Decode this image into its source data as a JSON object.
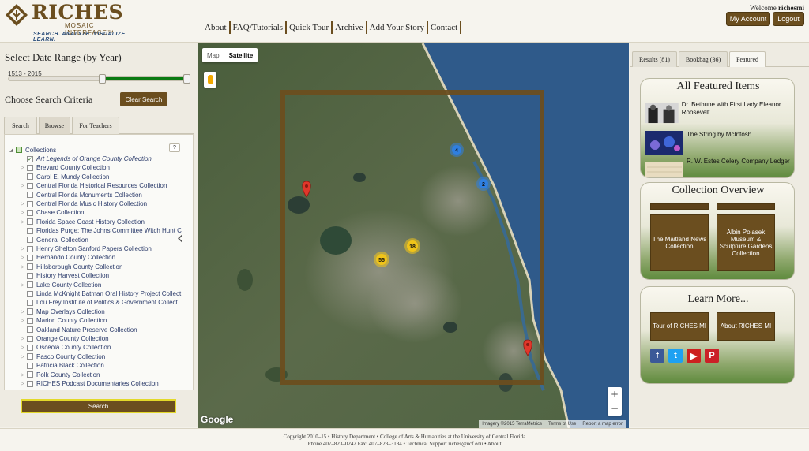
{
  "header": {
    "logo_title": "RICHES",
    "logo_subtitle": "MOSAIC INTERFACE™",
    "logo_tagline": "SEARCH. ANALYZE. VISUALIZE. LEARN.",
    "nav": [
      "About",
      "FAQ/Tutorials",
      "Quick Tour",
      "Archive",
      "Add Your Story",
      "Contact"
    ],
    "welcome_prefix": "Welcome ",
    "welcome_user": "richesmi",
    "my_account_label": "My Account",
    "logout_label": "Logout"
  },
  "left_panel": {
    "date_title": "Select Date Range (by Year)",
    "date_range": "1513 - 2015",
    "slider": {
      "min_year": 1513,
      "max_year": 2015,
      "selected_start_fraction": 0.52,
      "selected_end_fraction": 1.0
    },
    "criteria_title": "Choose Search Criteria",
    "clear_search_label": "Clear Search",
    "tabs": [
      "Search",
      "Browse",
      "For Teachers"
    ],
    "active_tab": "Browse",
    "tree_root": "Collections",
    "help_label": "?",
    "collections": [
      {
        "label": "Art Legends of Orange County Collection",
        "checked": true,
        "expandable": false,
        "italic": true
      },
      {
        "label": "Brevard County Collection",
        "checked": false,
        "expandable": true,
        "italic": false
      },
      {
        "label": "Carol E. Mundy Collection",
        "checked": false,
        "expandable": false,
        "italic": false
      },
      {
        "label": "Central Florida Historical Resources Collection",
        "checked": false,
        "expandable": true,
        "italic": false
      },
      {
        "label": "Central Florida Monuments Collection",
        "checked": false,
        "expandable": false,
        "italic": false
      },
      {
        "label": "Central Florida Music History Collection",
        "checked": false,
        "expandable": true,
        "italic": false
      },
      {
        "label": "Chase Collection",
        "checked": false,
        "expandable": true,
        "italic": false
      },
      {
        "label": "Florida Space Coast History Collection",
        "checked": false,
        "expandable": true,
        "italic": false
      },
      {
        "label": "Floridas Purge: The Johns Committee Witch Hunt C",
        "checked": false,
        "expandable": false,
        "italic": false
      },
      {
        "label": "General Collection",
        "checked": false,
        "expandable": false,
        "italic": false
      },
      {
        "label": "Henry Shelton Sanford Papers Collection",
        "checked": false,
        "expandable": true,
        "italic": false
      },
      {
        "label": "Hernando County Collection",
        "checked": false,
        "expandable": true,
        "italic": false
      },
      {
        "label": "Hillsborough County Collection",
        "checked": false,
        "expandable": true,
        "italic": false
      },
      {
        "label": "History Harvest Collection",
        "checked": false,
        "expandable": false,
        "italic": false
      },
      {
        "label": "Lake County Collection",
        "checked": false,
        "expandable": true,
        "italic": false
      },
      {
        "label": "Linda McKnight Batman Oral History Project Collect",
        "checked": false,
        "expandable": false,
        "italic": false
      },
      {
        "label": "Lou Frey Institute of Politics & Government Collect",
        "checked": false,
        "expandable": false,
        "italic": false
      },
      {
        "label": "Map Overlays Collection",
        "checked": false,
        "expandable": true,
        "italic": false
      },
      {
        "label": "Marion County Collection",
        "checked": false,
        "expandable": true,
        "italic": false
      },
      {
        "label": "Oakland Nature Preserve Collection",
        "checked": false,
        "expandable": false,
        "italic": false
      },
      {
        "label": "Orange County Collection",
        "checked": false,
        "expandable": true,
        "italic": false
      },
      {
        "label": "Osceola County Collection",
        "checked": false,
        "expandable": true,
        "italic": false
      },
      {
        "label": "Pasco County Collection",
        "checked": false,
        "expandable": true,
        "italic": false
      },
      {
        "label": "Patricia Black Collection",
        "checked": false,
        "expandable": false,
        "italic": false
      },
      {
        "label": "Polk County Collection",
        "checked": false,
        "expandable": true,
        "italic": false
      },
      {
        "label": "RICHES Podcast Documentaries Collection",
        "checked": false,
        "expandable": true,
        "italic": false
      }
    ],
    "search_button_label": "Search"
  },
  "map": {
    "type_buttons": [
      "Map",
      "Satellite"
    ],
    "active_type": "Satellite",
    "clusters": [
      {
        "count": "4",
        "color": "#2f7fe0"
      },
      {
        "count": "2",
        "color": "#2f7fe0"
      },
      {
        "count": "18",
        "color": "#f0c419"
      },
      {
        "count": "55",
        "color": "#f0c419"
      }
    ],
    "zoom_in": "+",
    "zoom_out": "−",
    "google_label": "Google",
    "attribution": [
      "Imagery ©2015 TerraMetrics",
      "Terms of Use",
      "Report a map error"
    ],
    "collapse_icon": "chevron-left-icon"
  },
  "right_panel": {
    "tabs": [
      "Results (81)",
      "Bookbag (36)",
      "Featured"
    ],
    "active_tab": "Featured",
    "featured_title": "All Featured Items",
    "featured_items": [
      "Dr. Bethune with First Lady Eleanor Roosevelt",
      "The String by McIntosh",
      "R. W. Estes Celery Company Ledger"
    ],
    "overview_title": "Collection Overview",
    "overview_items": [
      "The Maitland News Collection",
      "Albin Polasek Museum & Sculpture Gardens Collection"
    ],
    "learn_title": "Learn More...",
    "learn_items": [
      "Tour of RICHES MI",
      "About RICHES MI"
    ],
    "social_icons": [
      "facebook-icon",
      "twitter-icon",
      "youtube-icon",
      "pinterest-icon"
    ],
    "social_glyphs": [
      "f",
      "t",
      "▶",
      "P"
    ],
    "social_colors": [
      "#3b5998",
      "#1da1f2",
      "#cd201f",
      "#cb2027"
    ]
  },
  "footer": {
    "line1": "Copyright 2010–15 • History Department • College of Arts & Humanities at the University of Central Florida",
    "line2": "Phone 407–823–0242 Fax: 407–823–3184 • Technical Support riches@ucf.edu • About"
  }
}
